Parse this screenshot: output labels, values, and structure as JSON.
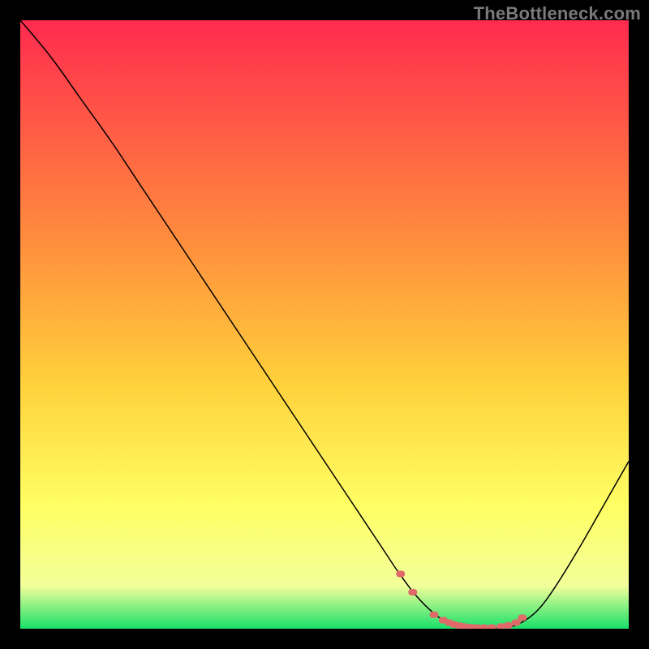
{
  "watermark": "TheBottleneck.com",
  "chart_data": {
    "type": "line",
    "title": "",
    "xlabel": "",
    "ylabel": "",
    "xlim": [
      0,
      100
    ],
    "ylim": [
      0,
      100
    ],
    "grid": false,
    "background_gradient": {
      "stops": [
        {
          "offset": 0,
          "color": "#ff2b4f"
        },
        {
          "offset": 35,
          "color": "#ff8a3d"
        },
        {
          "offset": 60,
          "color": "#ffd23c"
        },
        {
          "offset": 80,
          "color": "#ffff64"
        },
        {
          "offset": 93,
          "color": "#f2ff9a"
        },
        {
          "offset": 100,
          "color": "#18e06a"
        }
      ]
    },
    "series": [
      {
        "name": "bottleneck-curve",
        "type": "line",
        "color": "#000000",
        "width": 1.5,
        "x": [
          0,
          5,
          10,
          15,
          20,
          25,
          30,
          35,
          40,
          45,
          50,
          55,
          60,
          62,
          65,
          68,
          70,
          72,
          74,
          76,
          78,
          80,
          82,
          85,
          88,
          92,
          96,
          100
        ],
        "y": [
          100,
          94,
          87,
          80,
          72.5,
          65,
          57.5,
          50,
          42.5,
          35,
          27.5,
          20,
          12.5,
          9.5,
          5.5,
          2.5,
          1.2,
          0.5,
          0.2,
          0.15,
          0.15,
          0.3,
          0.8,
          3.0,
          7.0,
          13.5,
          20.5,
          27.5
        ]
      },
      {
        "name": "optimal-zone-markers",
        "type": "scatter",
        "color": "#e06a6a",
        "size": 6,
        "x": [
          62.5,
          64.5,
          68.0,
          69.5,
          70.5,
          71.3,
          72.2,
          73.0,
          74.0,
          75.0,
          76.2,
          77.5,
          79.0,
          80.2,
          81.5,
          82.5
        ],
        "y": [
          9.0,
          6.0,
          2.3,
          1.4,
          1.0,
          0.7,
          0.5,
          0.35,
          0.25,
          0.2,
          0.18,
          0.2,
          0.35,
          0.55,
          1.0,
          1.8
        ]
      }
    ]
  }
}
